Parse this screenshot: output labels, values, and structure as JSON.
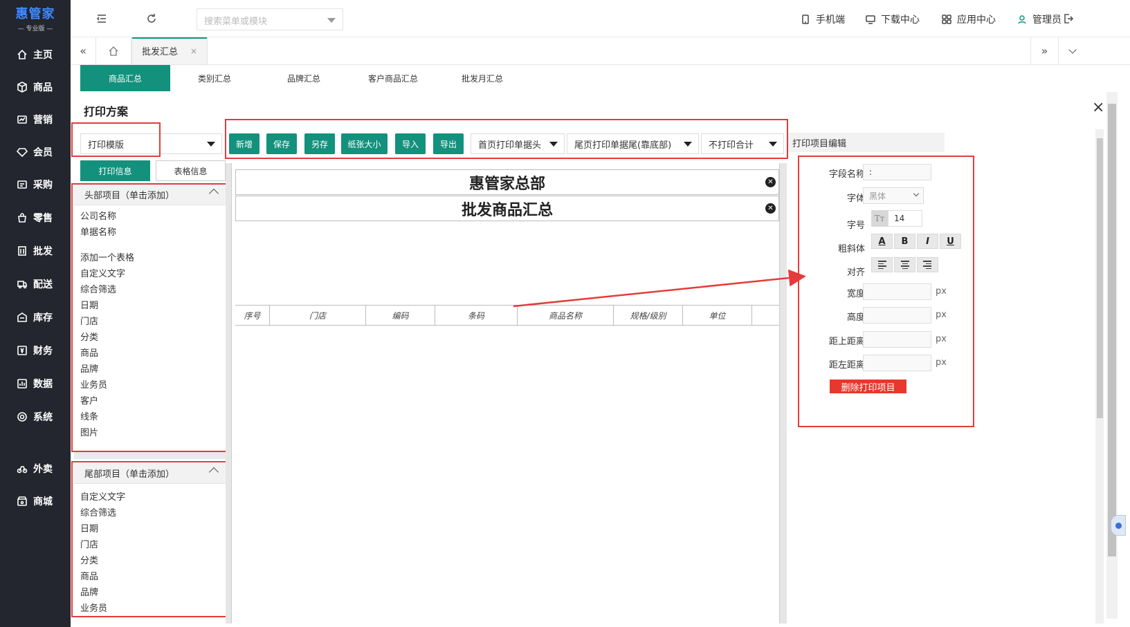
{
  "logo": {
    "main": "惠管家",
    "sub": "— 专业版 —"
  },
  "sidebar": {
    "items": [
      {
        "label": "主页",
        "icon": "home-icon"
      },
      {
        "label": "商品",
        "icon": "box-icon"
      },
      {
        "label": "营销",
        "icon": "chart-icon"
      },
      {
        "label": "会员",
        "icon": "diamond-icon"
      },
      {
        "label": "采购",
        "icon": "purchase-icon"
      },
      {
        "label": "零售",
        "icon": "bag-icon"
      },
      {
        "label": "批发",
        "icon": "building-icon"
      },
      {
        "label": "配送",
        "icon": "truck-icon"
      },
      {
        "label": "库存",
        "icon": "warehouse-icon"
      },
      {
        "label": "财务",
        "icon": "money-icon"
      },
      {
        "label": "数据",
        "icon": "data-icon"
      },
      {
        "label": "系统",
        "icon": "settings-icon"
      },
      {
        "label": "外卖",
        "icon": "delivery-icon"
      },
      {
        "label": "商城",
        "icon": "store-icon"
      }
    ]
  },
  "topbar": {
    "search_placeholder": "搜索菜单或模块",
    "mobile": "手机端",
    "download": "下载中心",
    "apps": "应用中心",
    "user": "管理员"
  },
  "tabs": {
    "open_tab": "批发汇总",
    "close": "×"
  },
  "report_tabs": [
    "商品汇总",
    "类别汇总",
    "品牌汇总",
    "客户商品汇总",
    "批发月汇总"
  ],
  "dialog": {
    "title": "打印方案",
    "close": "×",
    "template_select": "打印模版",
    "toolbar": {
      "add": "新增",
      "save": "保存",
      "save_as": "另存",
      "paper": "纸张大小",
      "import": "导入",
      "export": "导出",
      "header_opt": "首页打印单据头",
      "footer_opt": "尾页打印单据尾(靠底部)",
      "total_opt": "不打印合计"
    },
    "sub_tabs": {
      "print_info": "打印信息",
      "table_info": "表格信息"
    },
    "head_panel": {
      "title": "头部项目（单击添加）",
      "items": [
        "公司名称",
        "单据名称",
        "添加一个表格",
        "自定义文字",
        "综合筛选",
        "日期",
        "门店",
        "分类",
        "商品",
        "品牌",
        "业务员",
        "客户",
        "线条",
        "图片"
      ]
    },
    "foot_panel": {
      "title": "尾部项目（单击添加）",
      "items": [
        "自定义文字",
        "综合筛选",
        "日期",
        "门店",
        "分类",
        "商品",
        "品牌",
        "业务员"
      ]
    },
    "canvas": {
      "company": "惠管家总部",
      "doc_title": "批发商品汇总",
      "columns": [
        "序号",
        "门店",
        "编码",
        "条码",
        "商品名称",
        "规格/级别",
        "单位"
      ]
    },
    "editor": {
      "title": "打印项目编辑",
      "field_name_label": "字段名称",
      "field_name_value": ":",
      "font_label": "字体",
      "font_value": "黑体",
      "size_label": "字号",
      "size_value": "14",
      "style_label": "粗斜体",
      "style_buttons": [
        "A",
        "B",
        "I",
        "U"
      ],
      "align_label": "对齐",
      "width_label": "宽度",
      "height_label": "高度",
      "top_label": "距上距离",
      "left_label": "距左距离",
      "unit": "px",
      "delete": "删除打印项目"
    }
  },
  "colors": {
    "primary": "#13917d",
    "sidebar_bg": "#23262e",
    "danger": "#e8372d",
    "annotation": "#e63b3b"
  }
}
